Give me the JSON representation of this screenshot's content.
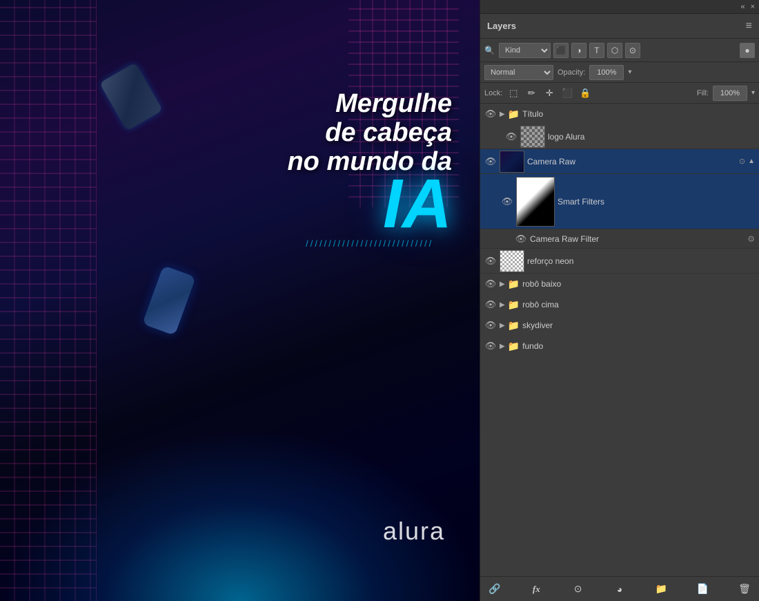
{
  "topBar": {
    "collapseLabel": "«",
    "closeLabel": "×"
  },
  "layersPanel": {
    "title": "Layers",
    "menuIcon": "≡",
    "filter": {
      "searchIcon": "🔍",
      "kindLabel": "Kind",
      "icons": [
        "pixel",
        "adjustment",
        "type",
        "shape",
        "smart"
      ]
    },
    "blendMode": {
      "value": "Normal",
      "opacityLabel": "Opacity:",
      "opacityValue": "100%"
    },
    "lockBar": {
      "lockLabel": "Lock:",
      "fillLabel": "Fill:",
      "fillValue": "100%"
    },
    "layers": [
      {
        "id": "titulo-group",
        "type": "group",
        "name": "Título",
        "visible": true,
        "indent": 0
      },
      {
        "id": "logo-alura",
        "type": "layer",
        "name": "logo Alura",
        "visible": true,
        "thumb": "checker",
        "indent": 1
      },
      {
        "id": "camera-raw",
        "type": "layer",
        "name": "Camera Raw",
        "visible": true,
        "thumb": "scene",
        "indent": 0,
        "selected": true,
        "hasSettings": true,
        "expanded": true
      },
      {
        "id": "smart-filters",
        "type": "smart-filter-container",
        "name": "Smart Filters",
        "visible": true,
        "thumb": "white-black",
        "indent": 1
      },
      {
        "id": "camera-raw-filter",
        "type": "smart-filter-item",
        "name": "Camera Raw Filter",
        "visible": true,
        "indent": 2
      },
      {
        "id": "reforco-neon",
        "type": "layer",
        "name": "reforço neon",
        "visible": true,
        "thumb": "checker-small",
        "indent": 0
      },
      {
        "id": "robo-baixo",
        "type": "group",
        "name": "robô baixo",
        "visible": true,
        "indent": 0
      },
      {
        "id": "robo-cima",
        "type": "group",
        "name": "robô cima",
        "visible": true,
        "indent": 0
      },
      {
        "id": "skydiver",
        "type": "group",
        "name": "skydiver",
        "visible": true,
        "indent": 0
      },
      {
        "id": "fundo",
        "type": "group",
        "name": "fundo",
        "visible": true,
        "indent": 0
      }
    ],
    "bottomBar": {
      "linkIcon": "🔗",
      "fxIcon": "fx",
      "adjustmentIcon": "⊙",
      "colorFillIcon": "◕",
      "newGroupIcon": "📁",
      "newLayerIcon": "📄",
      "deleteIcon": "🗑"
    }
  },
  "canvas": {
    "title1": "Mergulhe",
    "title2": "de cabeça",
    "title3": "no mundo da",
    "titleIA": "IA",
    "titleUnderline": "////////////////////////////",
    "brand": "alura"
  }
}
